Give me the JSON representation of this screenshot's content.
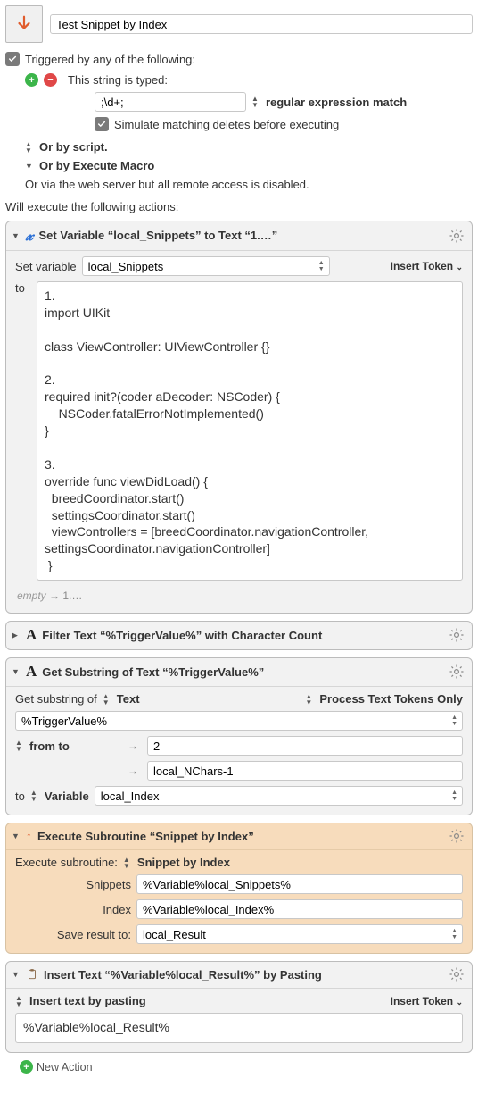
{
  "title": "Test Snippet by Index",
  "triggered_label": "Triggered by any of the following:",
  "string_typed_label": "This string is typed:",
  "typed_value": ";\\d+;",
  "regex_match_label": "regular expression match",
  "simulate_label": "Simulate matching deletes before executing",
  "or_script_label": "Or by script.",
  "or_execute_macro_label": "Or by Execute Macro",
  "or_webserver_label": "Or via the web server but all remote access is disabled.",
  "will_execute_label": "Will execute the following actions:",
  "actions": {
    "setvar": {
      "title": "Set Variable “local_Snippets” to Text “1.…”",
      "set_variable_label": "Set variable",
      "variable_name": "local_Snippets",
      "insert_token_label": "Insert Token",
      "to_label": "to",
      "text_value": "1.\nimport UIKit\n\nclass ViewController: UIViewController {}\n\n2.\nrequired init?(coder aDecoder: NSCoder) {\n    NSCoder.fatalErrorNotImplemented()\n}\n\n3.\noverride func viewDidLoad() {\n  breedCoordinator.start()\n  settingsCoordinator.start()\n  viewControllers = [breedCoordinator.navigationController, settingsCoordinator.navigationController]\n }",
      "footer_empty": "empty",
      "footer_rest": " → 1.…"
    },
    "filter": {
      "title": "Filter Text “%TriggerValue%” with Character Count"
    },
    "substring": {
      "title": "Get Substring of Text “%TriggerValue%”",
      "get_substring_label": "Get substring of",
      "text_opt": "Text",
      "process_tokens_label": "Process Text Tokens Only",
      "source_value": "%TriggerValue%",
      "from_to_label": "from to",
      "from_value": "2",
      "to_value": "local_NChars-1",
      "to_label": "to",
      "variable_opt": "Variable",
      "dest_var": "local_Index"
    },
    "subroutine": {
      "title": "Execute Subroutine “Snippet by Index”",
      "exec_label": "Execute subroutine:",
      "sub_name": "Snippet by Index",
      "param1_label": "Snippets",
      "param1_value": "%Variable%local_Snippets%",
      "param2_label": "Index",
      "param2_value": "%Variable%local_Index%",
      "save_label": "Save result to:",
      "save_value": "local_Result"
    },
    "insert": {
      "title": "Insert Text “%Variable%local_Result%” by Pasting",
      "mode_label": "Insert text by pasting",
      "insert_token_label": "Insert Token",
      "text_value": "%Variable%local_Result%"
    }
  },
  "new_action_label": "New Action"
}
